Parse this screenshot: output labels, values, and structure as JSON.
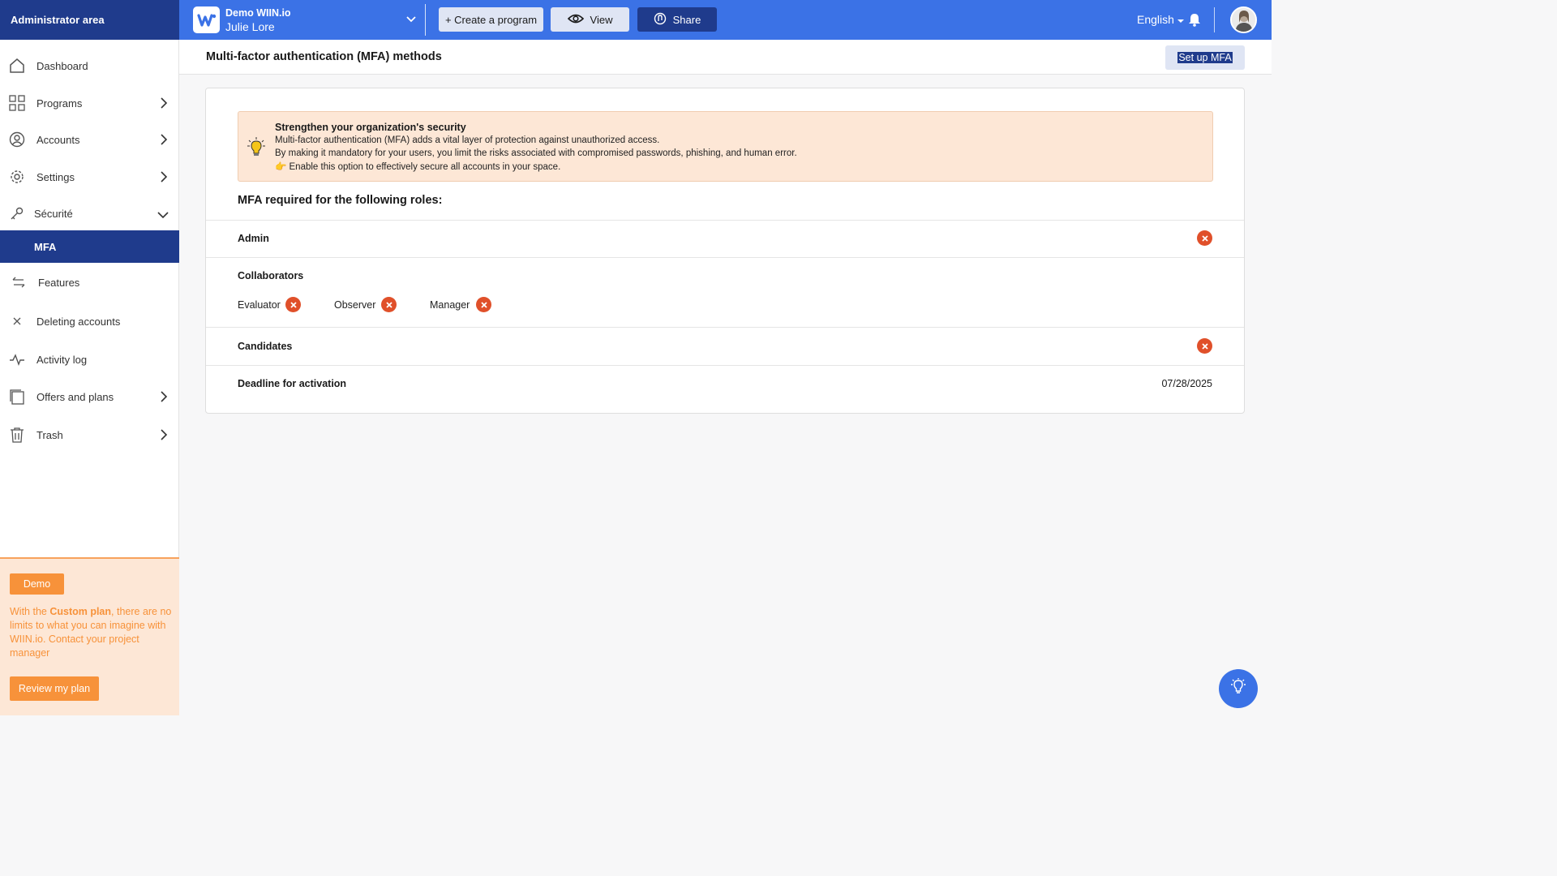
{
  "header": {
    "admin_area": "Administrator area",
    "org_name": "Demo WIIN.io",
    "user_name": "Julie Lore",
    "create_program": "+ Create a program",
    "view": "View",
    "share": "Share",
    "language": "English"
  },
  "sidebar": {
    "items": [
      {
        "label": "Dashboard",
        "icon": "home-icon"
      },
      {
        "label": "Programs",
        "icon": "grid-icon"
      },
      {
        "label": "Accounts",
        "icon": "user-circle-icon"
      },
      {
        "label": "Settings",
        "icon": "gear-icon"
      },
      {
        "label": "Sécurité",
        "icon": "key-icon"
      },
      {
        "label": "MFA",
        "icon": ""
      },
      {
        "label": "Features",
        "icon": "arrows-icon"
      },
      {
        "label": "Deleting accounts",
        "icon": "close-icon"
      },
      {
        "label": "Activity log",
        "icon": "pulse-icon"
      },
      {
        "label": "Offers and plans",
        "icon": "copy-icon"
      },
      {
        "label": "Trash",
        "icon": "trash-icon"
      }
    ],
    "promo": {
      "tag": "Demo",
      "text_before": "With the ",
      "text_bold": "Custom plan",
      "text_after": ", there are no limits to what you can imagine with WIIN.io. Contact your project manager",
      "button": "Review my plan"
    }
  },
  "page": {
    "title": "Multi-factor authentication (MFA) methods",
    "setup_button": "Set up MFA"
  },
  "alert": {
    "title": "Strengthen your organization's security",
    "line1": "Multi-factor authentication (MFA) adds a vital layer of protection against unauthorized access.",
    "line2": "By making it mandatory for your users, you limit the risks associated with compromised passwords, phishing, and human error.",
    "line3": "👉 Enable this option to effectively secure all accounts in your space."
  },
  "roles": {
    "title": "MFA required for the following roles:",
    "admin": "Admin",
    "collaborators": "Collaborators",
    "collaborator_roles": [
      "Evaluator",
      "Observer",
      "Manager"
    ],
    "candidates": "Candidates",
    "deadline_label": "Deadline for activation",
    "deadline_value": "07/28/2025"
  },
  "colors": {
    "primary": "#3b72e6",
    "navy": "#1f3b8c",
    "orange": "#f7923a",
    "danger": "#e0502a"
  }
}
